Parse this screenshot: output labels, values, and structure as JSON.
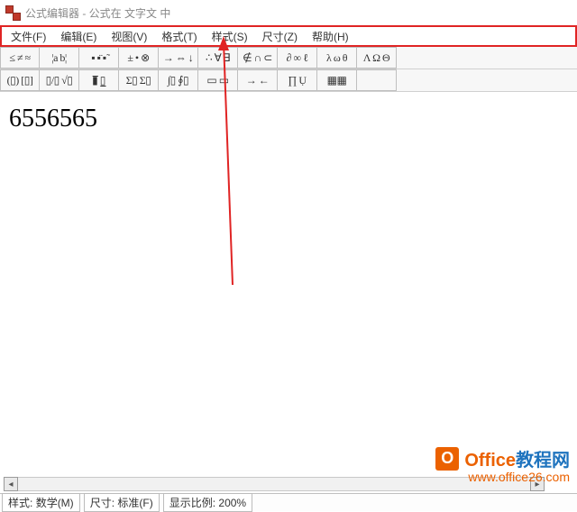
{
  "titlebar": {
    "title": "公式编辑器 - 公式在 文字文 中"
  },
  "menubar": {
    "items": [
      {
        "label": "文件(F)"
      },
      {
        "label": "编辑(E)"
      },
      {
        "label": "视图(V)"
      },
      {
        "label": "格式(T)"
      },
      {
        "label": "样式(S)"
      },
      {
        "label": "尺寸(Z)"
      },
      {
        "label": "帮助(H)"
      }
    ]
  },
  "toolbar1": [
    "≤ ≠ ≈",
    "¦a b¦",
    "▪ ▪̈ ▪̃",
    "± • ⊗",
    "→ ⇔ ↓",
    "∴ ∀ ∃",
    "∉ ∩ ⊂",
    "∂ ∞ ℓ",
    "λ ω θ",
    "Λ Ω Θ"
  ],
  "toolbar2": [
    "(▯) [▯]",
    "▯/▯ √▯",
    "▮̅ ▯̲",
    "Σ▯ Σ▯",
    "∫▯ ∮▯",
    "▭ ▭",
    "→ ←",
    "∏ Ụ",
    "▦▦",
    ""
  ],
  "content": {
    "formula": "6556565"
  },
  "statusbar": {
    "style_label": "样式:",
    "style_value": "数学(M)",
    "size_label": "尺寸:",
    "size_value": "标准(F)",
    "zoom_label": "显示比例:",
    "zoom_value": "200%"
  },
  "watermark": {
    "brand_a": "Office",
    "brand_b": "教程网",
    "url": "www.office26.com"
  },
  "colors": {
    "highlight": "#e02424",
    "brand_orange": "#eb6100",
    "brand_blue": "#1e73be"
  }
}
